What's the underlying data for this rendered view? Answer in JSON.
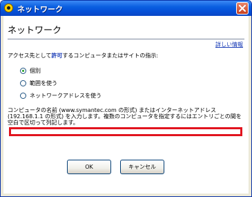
{
  "window": {
    "title": "ネットワーク",
    "close_label": "×"
  },
  "page": {
    "heading": "ネットワーク",
    "help_link": "詳しい情報",
    "instruction_prefix": "アクセス先として",
    "instruction_keyword": "許可",
    "instruction_suffix": "するコンピュータまたはサイトの指示:"
  },
  "options": [
    {
      "label": "個別",
      "checked": true
    },
    {
      "label": "範囲を使う",
      "checked": false
    },
    {
      "label": "ネットワークアドレスを使う",
      "checked": false
    }
  ],
  "description": "コンピュータの名前 (www.symantec.com の形式) またはインターネットアドレス (192.168.1.1 の形式) を入力します。複数のコンピュータを指定するにはエントリごとの間を空白で区切って列記します。",
  "address_input": {
    "value": "",
    "highlight_color": "#e1141e"
  },
  "buttons": {
    "ok": "OK",
    "cancel": "キャンセル"
  }
}
